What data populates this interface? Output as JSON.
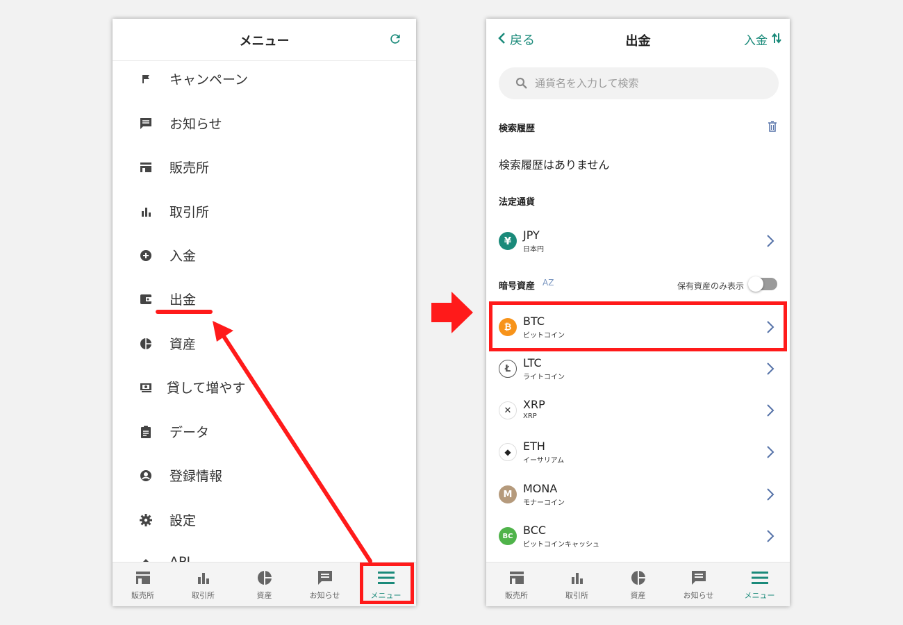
{
  "colors": {
    "accent": "#1a8a7a",
    "annotation": "#ff1a1a",
    "icon": "#444444",
    "chevron": "#5572a8"
  },
  "left_screen": {
    "title": "メニュー",
    "refresh_icon": "refresh-icon",
    "menu_items": [
      {
        "label": "キャンペーン",
        "icon": "flag-icon"
      },
      {
        "label": "お知らせ",
        "icon": "message-icon"
      },
      {
        "label": "販売所",
        "icon": "store-icon"
      },
      {
        "label": "取引所",
        "icon": "bar-chart-icon"
      },
      {
        "label": "入金",
        "icon": "plus-circle-icon"
      },
      {
        "label": "出金",
        "icon": "wallet-icon"
      },
      {
        "label": "資産",
        "icon": "pie-chart-icon"
      },
      {
        "label": "貸して増やす",
        "icon": "cash-icon"
      },
      {
        "label": "データ",
        "icon": "clipboard-icon"
      },
      {
        "label": "登録情報",
        "icon": "account-icon"
      },
      {
        "label": "設定",
        "icon": "gear-icon"
      },
      {
        "label": "API",
        "icon": "api-icon"
      }
    ]
  },
  "right_screen": {
    "back_label": "戻る",
    "title": "出金",
    "deposit_label": "入金",
    "search_placeholder": "通貨名を入力して検索",
    "history_title": "検索履歴",
    "history_empty": "検索履歴はありません",
    "fiat_title": "法定通貨",
    "fiat": [
      {
        "symbol": "JPY",
        "name": "日本円",
        "icon_glyph": "¥",
        "color": "#1a8a7a"
      }
    ],
    "crypto_title": "暗号資産",
    "sort_label": "AZ",
    "toggle_label": "保有資産のみ表示",
    "crypto": [
      {
        "symbol": "BTC",
        "name": "ビットコイン",
        "icon_glyph": "₿",
        "color": "#f7931a"
      },
      {
        "symbol": "LTC",
        "name": "ライトコイン",
        "icon_glyph": "Ł",
        "color": "#ffffff"
      },
      {
        "symbol": "XRP",
        "name": "XRP",
        "icon_glyph": "✕",
        "color": "#ffffff"
      },
      {
        "symbol": "ETH",
        "name": "イーサリアム",
        "icon_glyph": "◆",
        "color": "#ffffff"
      },
      {
        "symbol": "MONA",
        "name": "モナーコイン",
        "icon_glyph": "M",
        "color": "#b59a7c"
      },
      {
        "symbol": "BCC",
        "name": "ビットコインキャッシュ",
        "icon_glyph": "BC",
        "color": "#4fb34a"
      }
    ]
  },
  "tabbar": {
    "tabs": [
      {
        "label": "販売所",
        "icon": "store-icon"
      },
      {
        "label": "取引所",
        "icon": "bar-chart-icon"
      },
      {
        "label": "資産",
        "icon": "pie-chart-icon"
      },
      {
        "label": "お知らせ",
        "icon": "message-icon"
      },
      {
        "label": "メニュー",
        "icon": "hamburger-icon"
      }
    ],
    "active_index": 4
  }
}
